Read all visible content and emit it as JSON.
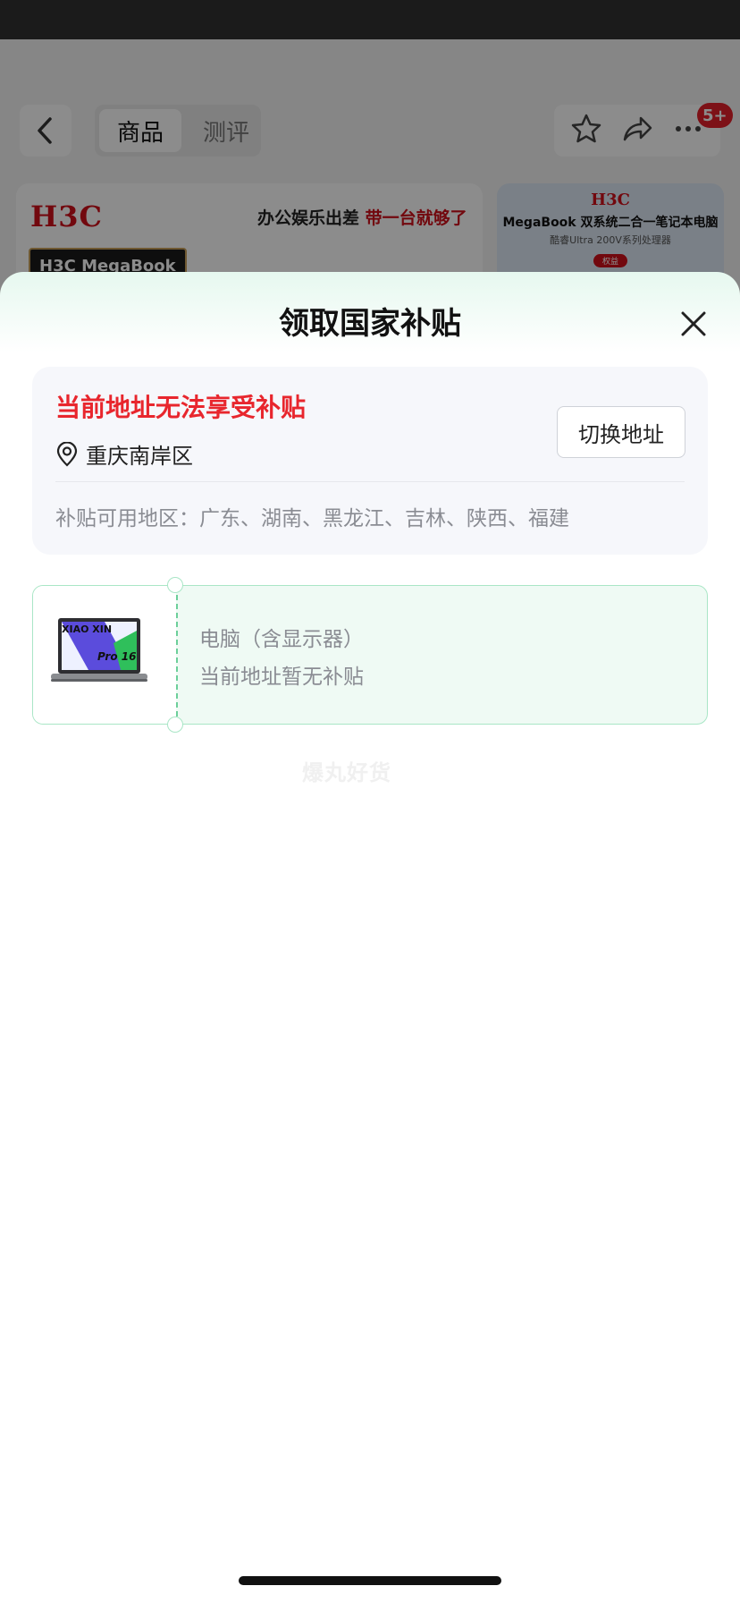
{
  "background": {
    "tabs": {
      "active": "商品",
      "inactive": "测评"
    },
    "badge": "5+",
    "banner": {
      "brand": "H3C",
      "slogan_black": "办公娱乐出差",
      "slogan_red": "带一台就够了",
      "model": "H3C MegaBook"
    },
    "side_card": {
      "brand": "H3C",
      "title": "MegaBook 双系统二合一笔记本电脑",
      "subtitle": "酷睿Ultra 200V系列处理器",
      "pill": "权益"
    }
  },
  "sheet": {
    "title": "领取国家补贴",
    "address": {
      "warning": "当前地址无法享受补贴",
      "location": "重庆南岸区",
      "switch_label": "切换地址",
      "regions": "补贴可用地区：广东、湖南、黑龙江、吉林、陕西、福建"
    },
    "coupon": {
      "product_image_text": {
        "brand": "XIAO XIN",
        "model": "Pro 16"
      },
      "name": "电脑（含显示器）",
      "status": "当前地址暂无补贴"
    },
    "watermark": "爆丸好货"
  },
  "colors": {
    "warning": "#e8262d",
    "coupon_border": "#a9e6c6",
    "coupon_bg": "#effaf4",
    "brand_red": "#d0101b"
  },
  "icons": [
    "back-icon",
    "star-icon",
    "share-icon",
    "more-icon",
    "close-icon",
    "location-pin-icon"
  ]
}
